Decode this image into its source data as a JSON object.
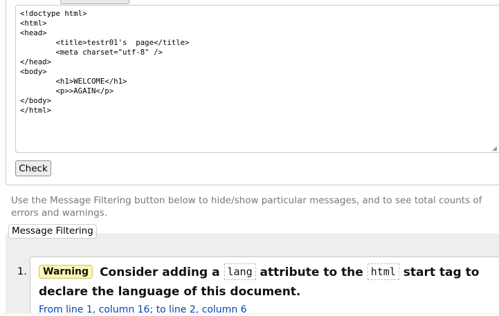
{
  "form": {
    "source_code": "<!doctype html>\n<html>\n<head>\n\t<title>testr01's  page</title>\n\t<meta charset=\"utf-8\" />\n</head>\n<body>\n\t<h1>WELCOME</h1>\n\t<p>>AGAIN</p>\n</body>\n</html>",
    "check_label": "Check"
  },
  "filter_note": "Use the Message Filtering button below to hide/show particular messages, and to see total counts of errors and warnings.",
  "filter_button_label": "Message Filtering",
  "messages": [
    {
      "number": "1.",
      "type": "Warning",
      "text_before": "Consider adding a",
      "code1": "lang",
      "text_middle": "attribute to the",
      "code2": "html",
      "text_after": "start tag to declare the language of this document.",
      "location": "From line 1, column 16; to line 2, column 6"
    }
  ]
}
